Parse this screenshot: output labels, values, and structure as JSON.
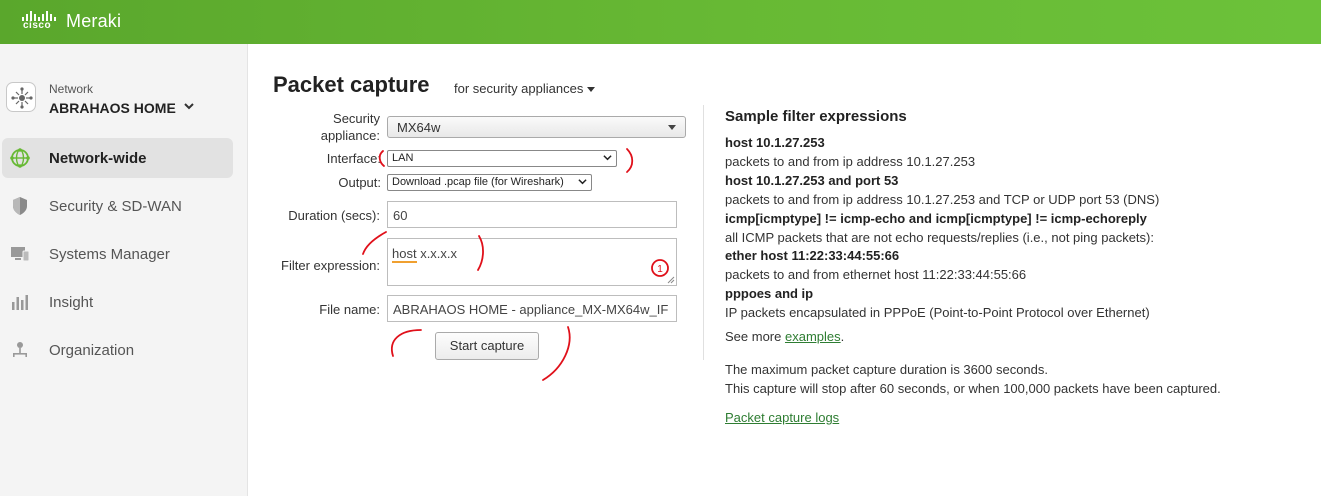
{
  "header": {
    "brand_small": "cisco",
    "brand": "Meraki"
  },
  "sidebar": {
    "network_label": "Network",
    "network_name": "ABRAHAOS HOME",
    "items": [
      {
        "label": "Network-wide",
        "icon": "network-globe-icon",
        "active": true
      },
      {
        "label": "Security & SD-WAN",
        "icon": "shield-icon",
        "active": false
      },
      {
        "label": "Systems Manager",
        "icon": "devices-icon",
        "active": false
      },
      {
        "label": "Insight",
        "icon": "bar-chart-icon",
        "active": false
      },
      {
        "label": "Organization",
        "icon": "org-tree-icon",
        "active": false
      }
    ]
  },
  "page": {
    "title": "Packet capture",
    "subtitle": "for security appliances"
  },
  "form": {
    "appliance_label_1": "Security",
    "appliance_label_2": "appliance:",
    "appliance_value": "MX64w",
    "interface_label": "Interface:",
    "interface_value": "LAN",
    "output_label": "Output:",
    "output_value": "Download .pcap file (for Wireshark)",
    "duration_label": "Duration (secs):",
    "duration_value": "60",
    "filter_label": "Filter expression:",
    "filter_word": "host",
    "filter_rest": " x.x.x.x",
    "filename_label": "File name:",
    "filename_value": "ABRAHAOS HOME - appliance_MX-MX64w_IF",
    "start_button": "Start capture"
  },
  "help": {
    "title": "Sample filter expressions",
    "examples": [
      {
        "expr": "host 10.1.27.253",
        "desc": "packets to and from ip address 10.1.27.253"
      },
      {
        "expr": "host 10.1.27.253 and port 53",
        "desc": "packets to and from ip address 10.1.27.253 and TCP or UDP port 53 (DNS)"
      },
      {
        "expr": "icmp[icmptype] != icmp-echo and icmp[icmptype] != icmp-echoreply",
        "desc": "all ICMP packets that are not echo requests/replies (i.e., not ping packets):"
      },
      {
        "expr": "ether host 11:22:33:44:55:66",
        "desc": "packets to and from ethernet host 11:22:33:44:55:66"
      },
      {
        "expr": "pppoes and ip",
        "desc": "IP packets encapsulated in PPPoE (Point-to-Point Protocol over Ethernet)"
      }
    ],
    "see_more_prefix": "See more ",
    "see_more_link": "examples",
    "see_more_suffix": ".",
    "max_duration": "The maximum packet capture duration is 3600 seconds.",
    "stop_note": "This capture will stop after 60 seconds, or when 100,000 packets have been captured.",
    "logs_link": "Packet capture logs"
  },
  "annotation": {
    "marker": "1",
    "color": "#e0101a"
  }
}
